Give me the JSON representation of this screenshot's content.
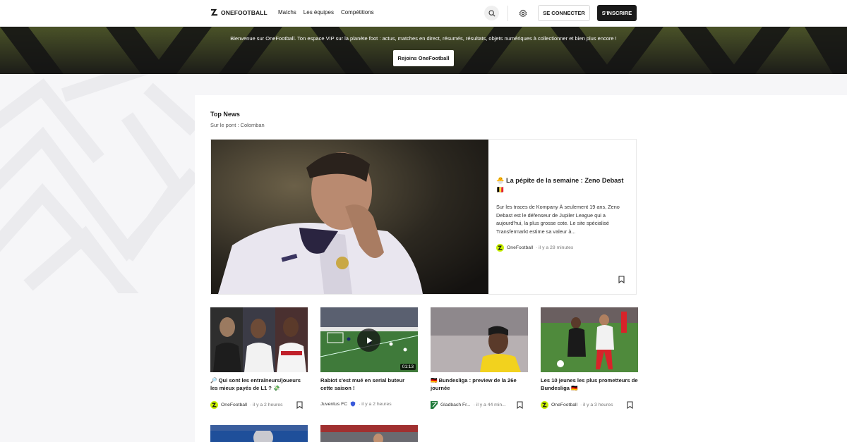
{
  "header": {
    "logo_text": "ONEFOOTBALL",
    "nav": [
      "Matchs",
      "Les équipes",
      "Compétitions"
    ],
    "login_label": "SE CONNECTER",
    "signup_label": "S'INSCRIRE"
  },
  "banner": {
    "text": "Bienvenue sur OneFootball. Ton espace VIP sur la planète foot : actus, matches en direct, résumés, résultats, objets numériques à collectionner et bien plus encore !",
    "button_label": "Rejoins OneFootball"
  },
  "top_news": {
    "title": "Top News",
    "subtitle": "Sur le pont : Colomban",
    "featured": {
      "title_emoji": "🐣",
      "title": "La pépite de la semaine : Zeno Debast",
      "flag": "🇧🇪",
      "excerpt": "Sur les traces de Kompany À seulement 19 ans, Zeno Debast est le défenseur de Jupiler League qui a aujourd'hui, la plus grosse cote. Le site spécialisé Transfermarkt estime sa valeur à...",
      "source": "OneFootball",
      "time": "· il y a 28 minutes"
    },
    "cards": [
      {
        "title": "🔎 Qui sont les entraîneurs/joueurs les mieux payés de L1 ? 💸",
        "source": "OneFootball",
        "time": "· il y a 2 heures"
      },
      {
        "title": "Rabiot s'est mué en serial buteur cette saison !",
        "source": "Juventus FC",
        "time": "· il y a 2 heures",
        "duration": "01:13"
      },
      {
        "title": "🇩🇪 Bundesliga : preview de la 26e journée",
        "source": "Gladbach Fr...",
        "time": "· il y a 44 min..."
      },
      {
        "title": "Les 10 jeunes les plus prometteurs de Bundesliga 🇩🇪",
        "source": "OneFootball",
        "time": "· il y a 3 heures"
      }
    ]
  },
  "colors": {
    "accent": "#c8f000",
    "dark": "#1a1a1a",
    "banner_bg": "#2a2a22"
  },
  "icons": [
    "search-icon",
    "gear-icon",
    "bookmark-icon",
    "play-icon"
  ]
}
